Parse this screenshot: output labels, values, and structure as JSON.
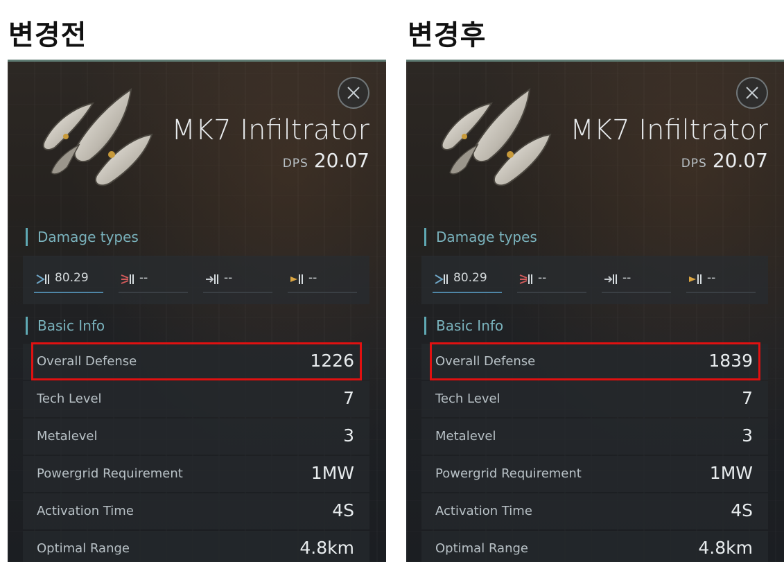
{
  "headings": {
    "before": "변경전",
    "after": "변경후"
  },
  "panels": [
    {
      "item_name": "MK7 Infiltrator",
      "dps_label": "DPS",
      "dps_value": "20.07",
      "damage_section_title": "Damage types",
      "damage": [
        {
          "icon": "em-damage-icon",
          "value": "80.29"
        },
        {
          "icon": "thermal-damage-icon",
          "value": "--"
        },
        {
          "icon": "kinetic-damage-icon",
          "value": "--"
        },
        {
          "icon": "explosive-damage-icon",
          "value": "--"
        }
      ],
      "basic_section_title": "Basic Info",
      "rows": [
        {
          "label": "Overall Defense",
          "value": "1226"
        },
        {
          "label": "Tech Level",
          "value": "7"
        },
        {
          "label": "Metalevel",
          "value": "3"
        },
        {
          "label": "Powergrid Requirement",
          "value": "1MW"
        },
        {
          "label": "Activation Time",
          "value": "4S"
        },
        {
          "label": "Optimal Range",
          "value": "4.8km"
        }
      ]
    },
    {
      "item_name": "MK7 Infiltrator",
      "dps_label": "DPS",
      "dps_value": "20.07",
      "damage_section_title": "Damage types",
      "damage": [
        {
          "icon": "em-damage-icon",
          "value": "80.29"
        },
        {
          "icon": "thermal-damage-icon",
          "value": "--"
        },
        {
          "icon": "kinetic-damage-icon",
          "value": "--"
        },
        {
          "icon": "explosive-damage-icon",
          "value": "--"
        }
      ],
      "basic_section_title": "Basic Info",
      "rows": [
        {
          "label": "Overall Defense",
          "value": "1839"
        },
        {
          "label": "Tech Level",
          "value": "7"
        },
        {
          "label": "Metalevel",
          "value": "3"
        },
        {
          "label": "Powergrid Requirement",
          "value": "1MW"
        },
        {
          "label": "Activation Time",
          "value": "4S"
        },
        {
          "label": "Optimal Range",
          "value": "4.8km"
        }
      ]
    }
  ],
  "colors": {
    "accent": "#5fa9b4",
    "highlight": "#e01111"
  }
}
